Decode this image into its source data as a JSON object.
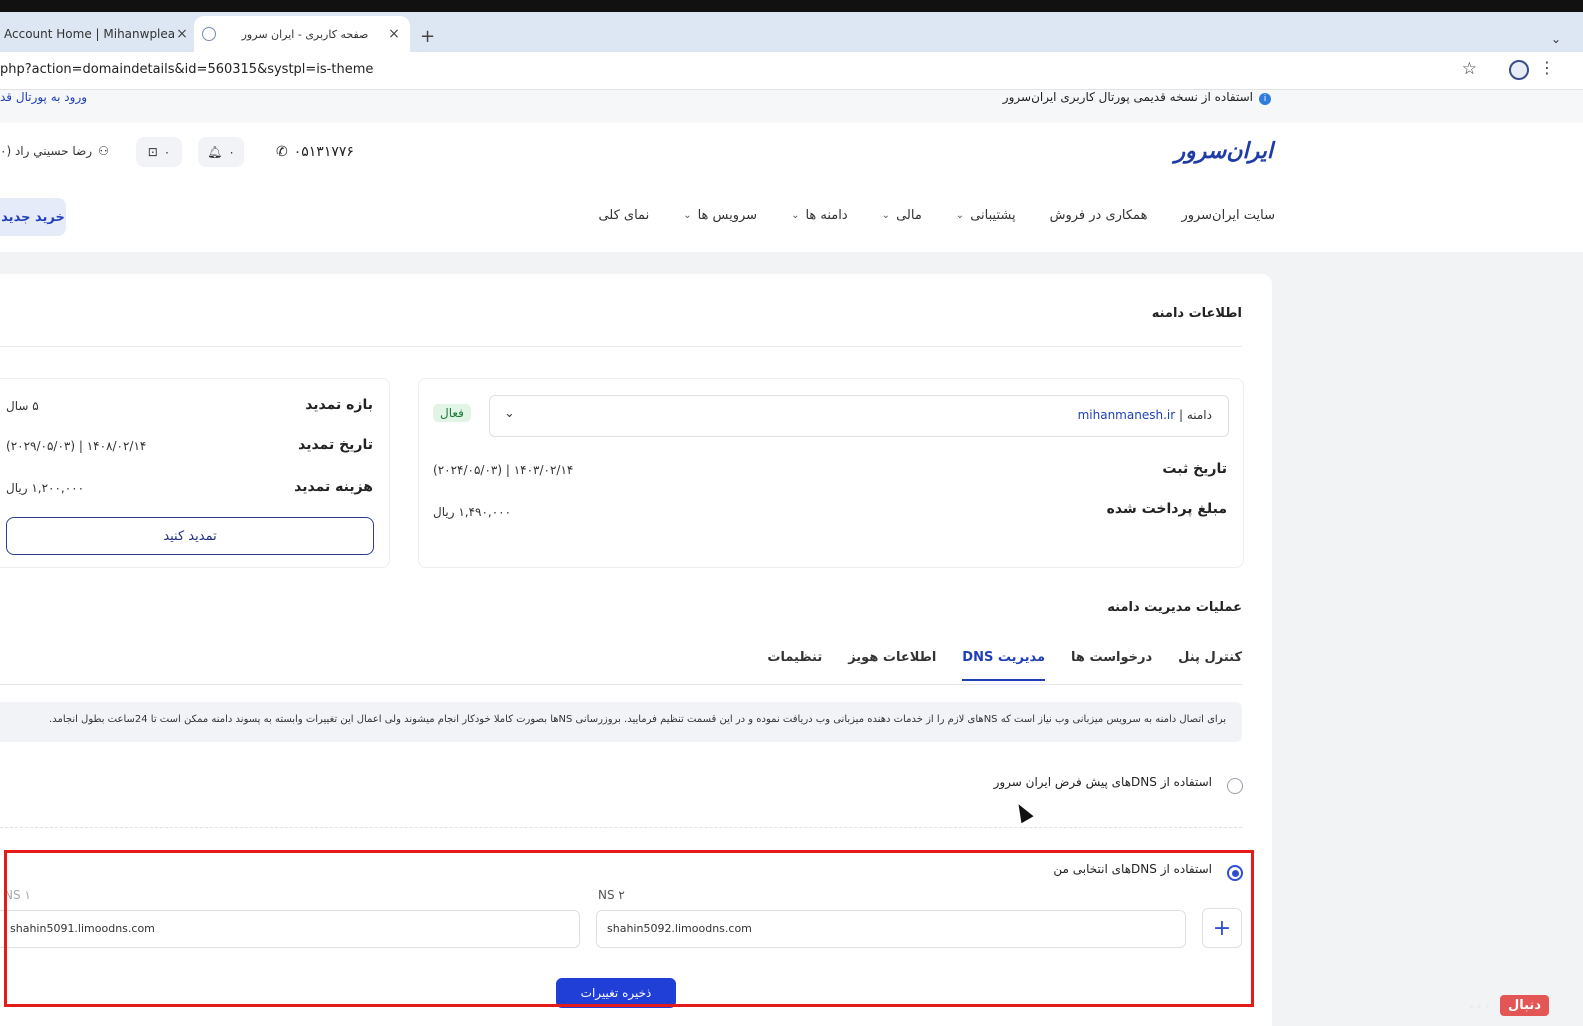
{
  "browser": {
    "tabs": [
      {
        "title": "Account Home | Mihanwplearn",
        "close": "×"
      },
      {
        "title": "صفحه کاربری - ایران سرور",
        "close": "×"
      }
    ],
    "new_tab": "+",
    "menu": "⌄",
    "url": "php?action=domaindetails&id=560315&systpl=is-theme",
    "star": "☆",
    "kebab": "⋮"
  },
  "header": {
    "notice": "استفاده از نسخه قدیمی پورتال کاربری ایران‌سرور",
    "info_icon": "i",
    "old_portal_link": "ورود به پورتال قد",
    "logo": "ایران‌سرور",
    "phone": "۰۵۱۳۱۷۷۶",
    "bell_count": "۰",
    "cart_count": "۰",
    "user_name": "رضا حسيني راد (۰",
    "nav": [
      {
        "label": "نمای کلی",
        "has_menu": false
      },
      {
        "label": "سرویس ها",
        "has_menu": true
      },
      {
        "label": "دامنه ها",
        "has_menu": true
      },
      {
        "label": "مالی",
        "has_menu": true
      },
      {
        "label": "پشتیبانی",
        "has_menu": true
      },
      {
        "label": "همکاری در فروش",
        "has_menu": false
      },
      {
        "label": "سایت ایران‌سرور",
        "has_menu": false
      }
    ],
    "buy_button": "خرید جدید"
  },
  "domain_info": {
    "title": "اطلاعات دامنه",
    "select_prefix": "دامنه | ",
    "domain": "mihanmanesh.ir",
    "status": "فعال",
    "reg_date_label": "تاریخ ثبت",
    "reg_date_value": "۱۴۰۳/۰۲/۱۴ | (۲۰۲۴/۰۵/۰۳)",
    "paid_label": "مبلغ پرداخت شده",
    "paid_value": "۱,۴۹۰,۰۰۰ ریال"
  },
  "renewal": {
    "period_label": "بازه تمدید",
    "period_value": "۵ سال",
    "date_label": "تاریخ تمدید",
    "date_value": "۱۴۰۸/۰۲/۱۴ | (۲۰۲۹/۰۵/۰۳)",
    "cost_label": "هزینه تمدید",
    "cost_value": "۱,۲۰۰,۰۰۰ ریال",
    "button": "تمدید کنید"
  },
  "operations": {
    "title": "عملیات مدیریت دامنه",
    "tabs": [
      "تنظیمات",
      "اطلاعات هویز",
      "مدیریت DNS",
      "درخواست ها",
      "کنترل پنل"
    ],
    "active_tab": "مدیریت DNS",
    "info_text": "برای اتصال دامنه به سرویس میزبانی وب نیاز است که NSهای لازم را از خدمات دهنده میزبانی وب دریافت نموده و در این قسمت تنظیم فرمایید. بروزرسانی NSها بصورت کاملا خودکار انجام میشوند ولی اعمال این تغییرات وابسته به پسوند دامنه ممکن است تا 24ساعت بطول انجامد.",
    "option_default": "استفاده از DNSهای پیش فرض ایران سرور",
    "option_custom": "استفاده از DNSهای انتخابی من",
    "ns1_label": "NS ۱",
    "ns1_value": "shahin5091.limoodns.com",
    "ns2_label": "NS ۲",
    "ns2_value": "shahin5092.limoodns.com",
    "add_icon": "+",
    "save_button": "ذخیره تغییرات"
  },
  "watermark": "دنبال",
  "colors": {
    "accent": "#1f3fd6",
    "highlight": "#e31b1b",
    "active_badge": "#1d7a3a"
  }
}
